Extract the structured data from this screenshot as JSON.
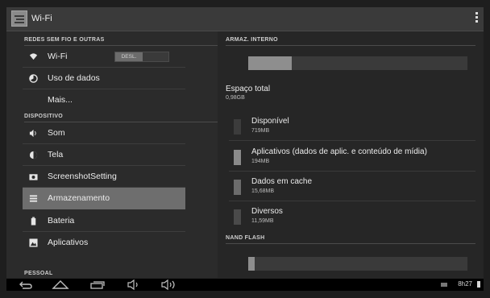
{
  "actionbar": {
    "title": "Wi-Fi",
    "app_icon": "settings-sliders-icon",
    "overflow_icon": "overflow-menu-icon"
  },
  "left": {
    "sections": [
      {
        "header": "REDES SEM FIO E OUTRAS"
      },
      {
        "header": "DISPOSITIVO"
      },
      {
        "header": "PESSOAL"
      }
    ],
    "items": [
      {
        "label": "Wi-Fi",
        "icon": "wifi-icon",
        "toggle": "DESL."
      },
      {
        "label": "Uso de dados",
        "icon": "data-usage-icon"
      },
      {
        "label": "Mais...",
        "icon": ""
      },
      {
        "label": "Som",
        "icon": "speaker-icon"
      },
      {
        "label": "Tela",
        "icon": "display-icon"
      },
      {
        "label": "ScreenshotSetting",
        "icon": "camera-icon"
      },
      {
        "label": "Armazenamento",
        "icon": "storage-icon",
        "selected": true
      },
      {
        "label": "Bateria",
        "icon": "battery-icon"
      },
      {
        "label": "Aplicativos",
        "icon": "apps-icon"
      }
    ]
  },
  "right": {
    "internal_header": "ARMAZ. INTERNO",
    "internal_used_fraction": 0.2,
    "total_label": "Espaço total",
    "total_value": "0,98GB",
    "rows": [
      {
        "label": "Disponível",
        "value": "719MB",
        "color": "#3c3c3c"
      },
      {
        "label": "Aplicativos (dados de aplic. e conteúdo de mídia)",
        "value": "194MB",
        "color": "#8a8a8a"
      },
      {
        "label": "Dados em cache",
        "value": "15,68MB",
        "color": "#6c6c6c"
      },
      {
        "label": "Diversos",
        "value": "11,59MB",
        "color": "#4a4a4a"
      }
    ],
    "nand_header": "NAND FLASH",
    "nand_used_fraction": 0.03
  },
  "navbar": {
    "buttons": [
      "back-icon",
      "home-icon",
      "recent-apps-icon",
      "volume-down-icon",
      "volume-up-icon"
    ],
    "time": "8h27"
  }
}
